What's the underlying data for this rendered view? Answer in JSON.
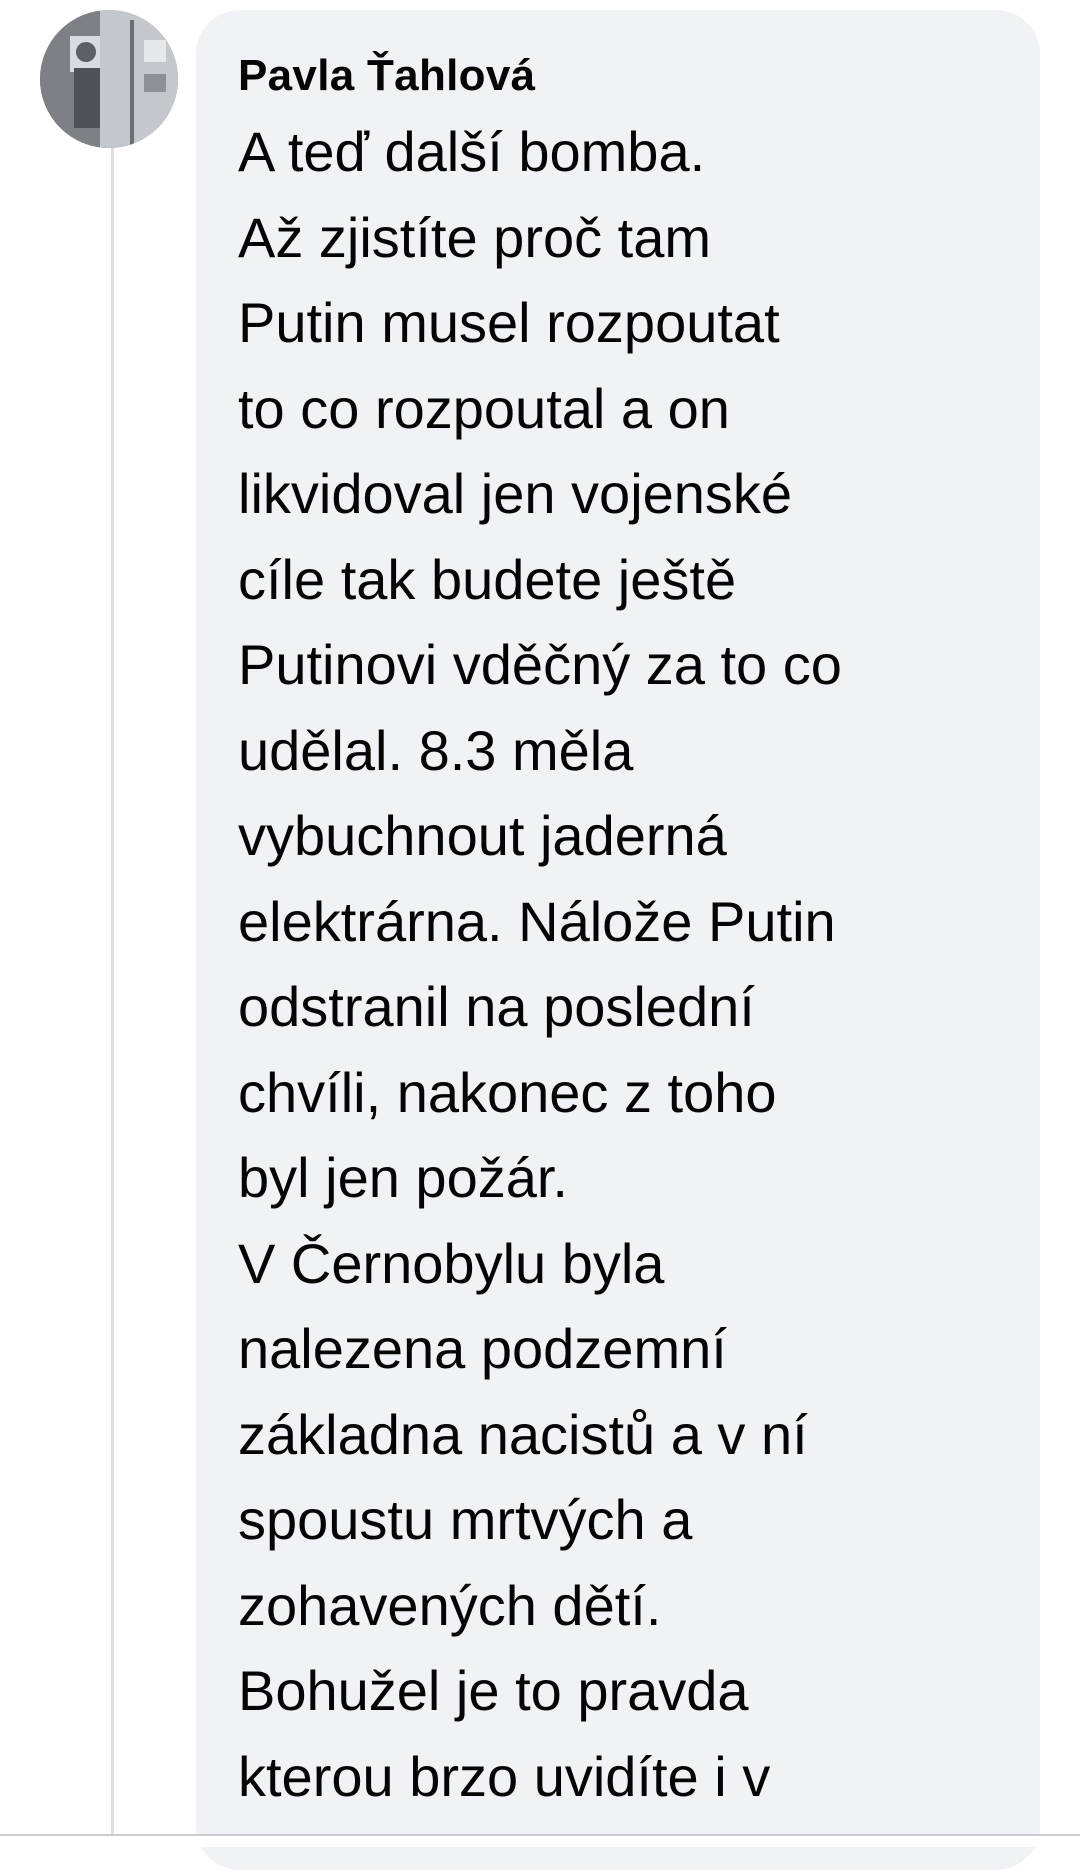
{
  "comment": {
    "author": "Pavla Ťahlová",
    "lines": [
      "A teď další bomba.",
      "Až zjistíte proč tam",
      "Putin musel rozpoutat",
      "to co rozpoutal a on",
      "likvidoval jen vojenské",
      "cíle tak budete ještě",
      "Putinovi vděčný za to co",
      "udělal. 8.3 měla",
      "vybuchnout jaderná",
      "elektrárna. Nálože Putin",
      "odstranil na poslední",
      "chvíli, nakonec z toho",
      "byl jen požár.",
      "V Černobylu byla",
      "nalezena podzemní",
      "základna nacistů a v ní",
      "spoustu mrtvých a",
      "zohavených dětí.",
      "Bohužel je to pravda",
      "kterou brzo uvidíte i v"
    ]
  },
  "avatar": {
    "icon": "profile-photo"
  },
  "colors": {
    "bubble_background": "#f0f2f5",
    "text": "#050505",
    "thread_line": "#dcdee2"
  }
}
